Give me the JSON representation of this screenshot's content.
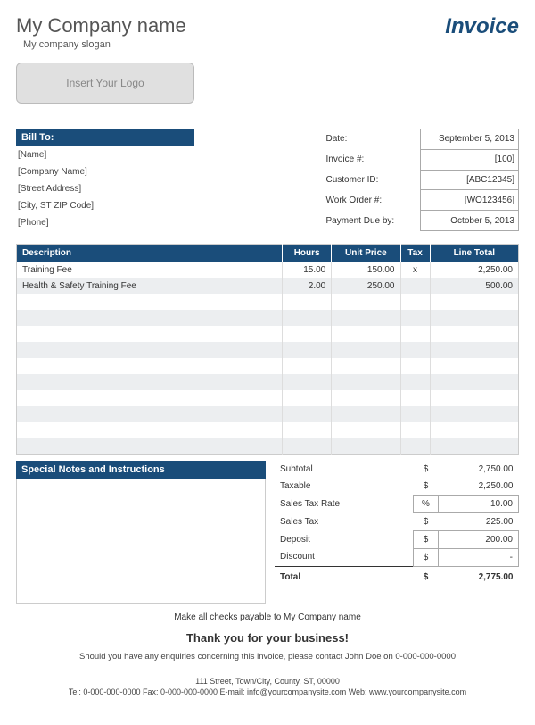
{
  "header": {
    "company_name": "My Company name",
    "slogan": "My company slogan",
    "invoice_title": "Invoice",
    "logo_placeholder": "Insert Your Logo"
  },
  "bill_to": {
    "header": "Bill To:",
    "name": "[Name]",
    "company": "[Company Name]",
    "street": "[Street Address]",
    "city": "[City, ST  ZIP Code]",
    "phone": "[Phone]"
  },
  "info": {
    "date_label": "Date:",
    "date_value": "September 5, 2013",
    "invoice_no_label": "Invoice #:",
    "invoice_no_value": "[100]",
    "customer_id_label": "Customer ID:",
    "customer_id_value": "[ABC12345]",
    "work_order_label": "Work Order #:",
    "work_order_value": "[WO123456]",
    "due_label": "Payment Due by:",
    "due_value": "October 5, 2013"
  },
  "items_header": {
    "description": "Description",
    "hours": "Hours",
    "unit_price": "Unit Price",
    "tax": "Tax",
    "line_total": "Line Total"
  },
  "items": [
    {
      "desc": "Training Fee",
      "hours": "15.00",
      "price": "150.00",
      "tax": "x",
      "total": "2,250.00"
    },
    {
      "desc": "Health & Safety Training Fee",
      "hours": "2.00",
      "price": "250.00",
      "tax": "",
      "total": "500.00"
    },
    {
      "desc": "",
      "hours": "",
      "price": "",
      "tax": "",
      "total": ""
    },
    {
      "desc": "",
      "hours": "",
      "price": "",
      "tax": "",
      "total": ""
    },
    {
      "desc": "",
      "hours": "",
      "price": "",
      "tax": "",
      "total": ""
    },
    {
      "desc": "",
      "hours": "",
      "price": "",
      "tax": "",
      "total": ""
    },
    {
      "desc": "",
      "hours": "",
      "price": "",
      "tax": "",
      "total": ""
    },
    {
      "desc": "",
      "hours": "",
      "price": "",
      "tax": "",
      "total": ""
    },
    {
      "desc": "",
      "hours": "",
      "price": "",
      "tax": "",
      "total": ""
    },
    {
      "desc": "",
      "hours": "",
      "price": "",
      "tax": "",
      "total": ""
    },
    {
      "desc": "",
      "hours": "",
      "price": "",
      "tax": "",
      "total": ""
    },
    {
      "desc": "",
      "hours": "",
      "price": "",
      "tax": "",
      "total": ""
    }
  ],
  "notes_header": "Special Notes and Instructions",
  "totals": {
    "subtotal_label": "Subtotal",
    "subtotal_sym": "$",
    "subtotal_val": "2,750.00",
    "taxable_label": "Taxable",
    "taxable_sym": "$",
    "taxable_val": "2,250.00",
    "rate_label": "Sales Tax Rate",
    "rate_sym": "%",
    "rate_val": "10.00",
    "tax_label": "Sales Tax",
    "tax_sym": "$",
    "tax_val": "225.00",
    "deposit_label": "Deposit",
    "deposit_sym": "$",
    "deposit_val": "200.00",
    "discount_label": "Discount",
    "discount_sym": "$",
    "discount_val": "-",
    "total_label": "Total",
    "total_sym": "$",
    "total_val": "2,775.00"
  },
  "footer": {
    "checks": "Make all checks payable to My Company name",
    "thankyou": "Thank you for your business!",
    "enquiry": "Should you have any enquiries concerning this invoice, please contact John Doe on 0-000-000-0000",
    "address": "111 Street, Town/City, County, ST, 00000",
    "contact": "Tel: 0-000-000-0000 Fax: 0-000-000-0000 E-mail: info@yourcompanysite.com Web: www.yourcompanysite.com"
  }
}
